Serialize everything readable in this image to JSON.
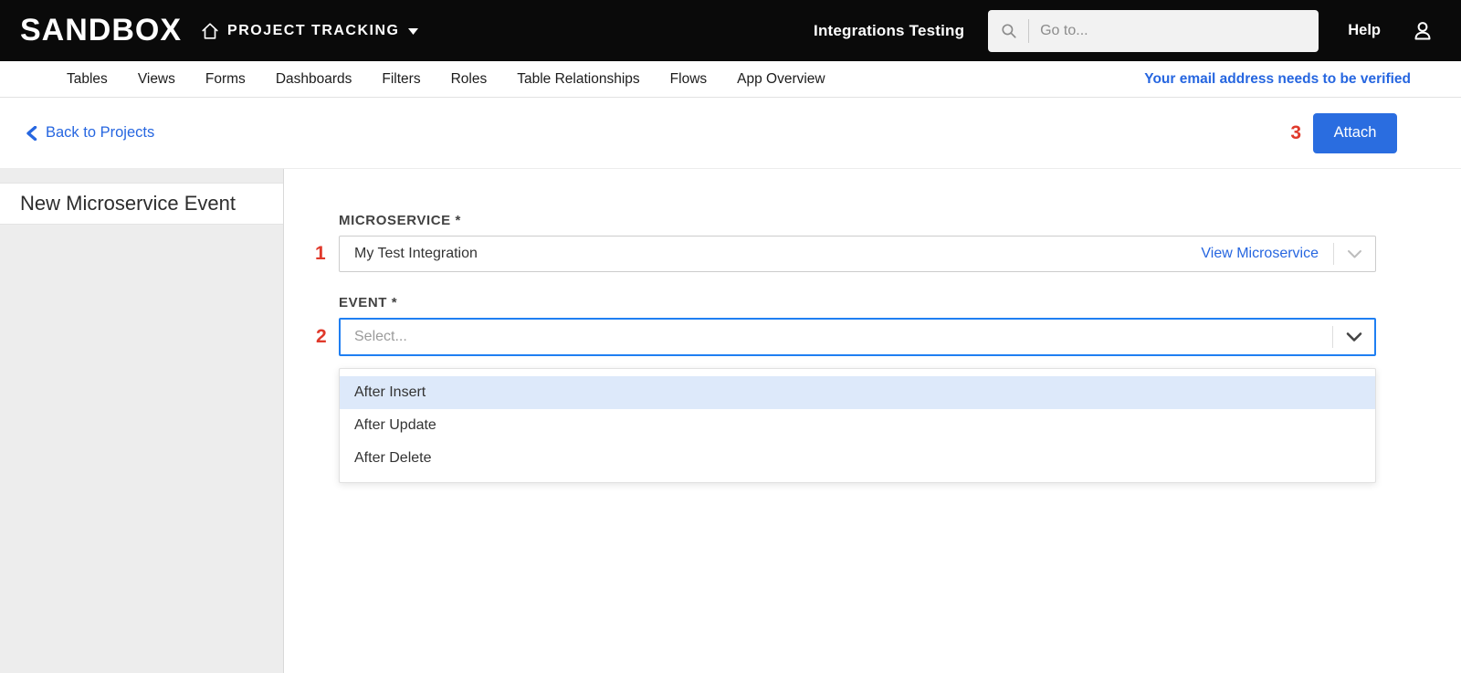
{
  "colors": {
    "topbar_bg": "#0a0a0a",
    "accent_blue": "#2a6de0",
    "link_blue": "#2666e0",
    "focus_border_blue": "#1f7ff2",
    "annotation_red": "#e0392b",
    "option_highlight": "#dde9fa",
    "sidebar_bg": "#ededed"
  },
  "topbar": {
    "logo": "SANDBOX",
    "app_switcher_label": "PROJECT TRACKING",
    "current_app": "Integrations Testing",
    "search_placeholder": "Go to...",
    "help_label": "Help"
  },
  "navbar": {
    "tabs": [
      "Tables",
      "Views",
      "Forms",
      "Dashboards",
      "Filters",
      "Roles",
      "Table Relationships",
      "Flows",
      "App Overview"
    ],
    "verification_alert": "Your email address needs to be verified"
  },
  "page_header": {
    "back_link": "Back to Projects",
    "annotation": "3",
    "attach_button": "Attach"
  },
  "sidebar": {
    "selected_item": "New Microservice Event"
  },
  "form": {
    "microservice": {
      "annotation": "1",
      "label": "MICROSERVICE *",
      "value": "My Test Integration",
      "view_link": "View Microservice"
    },
    "event": {
      "annotation": "2",
      "label": "EVENT *",
      "placeholder": "Select...",
      "options": [
        {
          "label": "After Insert",
          "highlighted": true
        },
        {
          "label": "After Update",
          "highlighted": false
        },
        {
          "label": "After Delete",
          "highlighted": false
        }
      ]
    }
  }
}
